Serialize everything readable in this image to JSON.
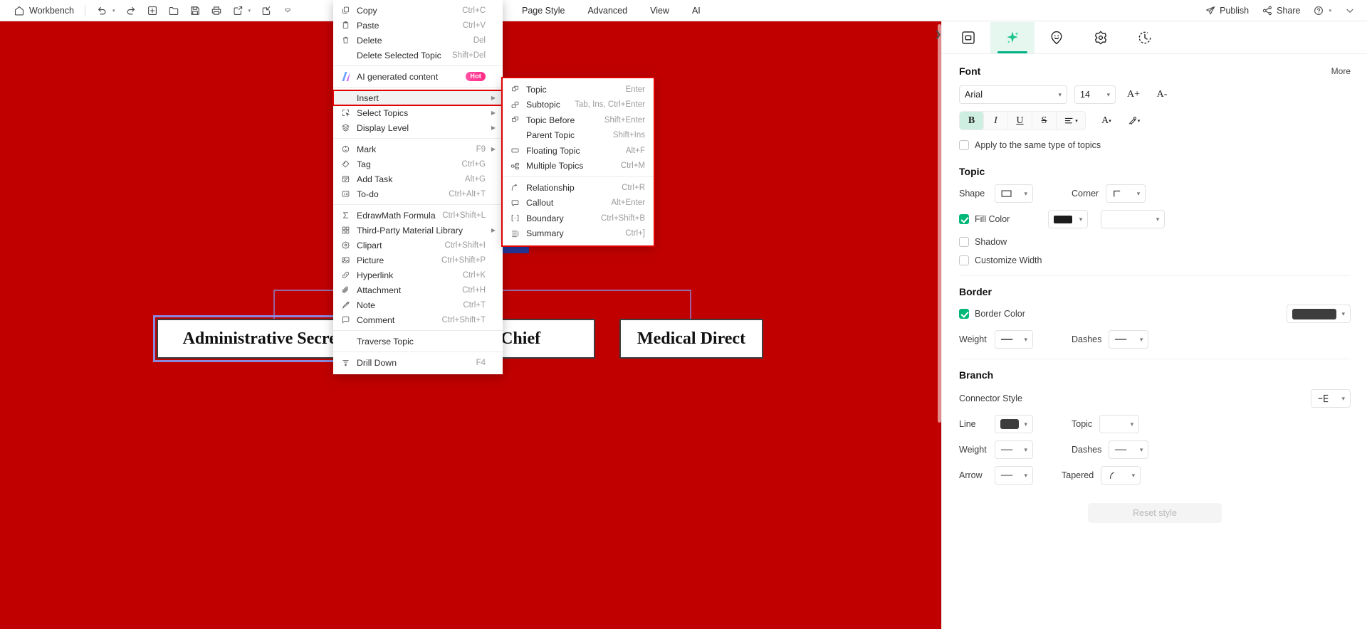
{
  "topbar": {
    "home_label": "Workbench",
    "left_tools": [
      {
        "name": "undo",
        "icon": "undo-icon",
        "caret": true
      },
      {
        "name": "redo",
        "icon": "redo-icon",
        "caret": false
      },
      {
        "name": "new",
        "icon": "new-file-icon",
        "caret": false
      },
      {
        "name": "open",
        "icon": "folder-open-icon",
        "caret": false
      },
      {
        "name": "save",
        "icon": "save-icon",
        "caret": false
      },
      {
        "name": "print",
        "icon": "print-icon",
        "caret": false
      },
      {
        "name": "export",
        "icon": "export-icon",
        "caret": true
      },
      {
        "name": "import",
        "icon": "import-icon",
        "caret": false
      },
      {
        "name": "more",
        "icon": "chevron-down-icon",
        "caret": false
      }
    ],
    "menu_tabs": [
      "Page Style",
      "Advanced",
      "View",
      "AI"
    ],
    "publish_label": "Publish",
    "share_label": "Share",
    "help_label": "?"
  },
  "context_menu": {
    "items": [
      {
        "label": "Copy",
        "shortcut": "Ctrl+C",
        "icon": "copy-icon",
        "arrow": false,
        "sep_after": false
      },
      {
        "label": "Paste",
        "shortcut": "Ctrl+V",
        "icon": "paste-icon",
        "arrow": false,
        "sep_after": false
      },
      {
        "label": "Delete",
        "shortcut": "Del",
        "icon": "trash-icon",
        "arrow": false,
        "sep_after": false
      },
      {
        "label": "Delete Selected Topic",
        "shortcut": "Shift+Del",
        "icon": "",
        "arrow": false,
        "sep_after": true
      },
      {
        "label": "AI generated content",
        "shortcut": "",
        "icon": "ai-icon",
        "arrow": false,
        "badge": "Hot",
        "sep_after": true
      },
      {
        "label": "Insert",
        "shortcut": "",
        "icon": "",
        "arrow": true,
        "highlight": true,
        "sep_after": false
      },
      {
        "label": "Select Topics",
        "shortcut": "",
        "icon": "select-topics-icon",
        "arrow": true,
        "sep_after": false
      },
      {
        "label": "Display Level",
        "shortcut": "",
        "icon": "layers-icon",
        "arrow": true,
        "sep_after": true
      },
      {
        "label": "Mark",
        "shortcut": "F9",
        "icon": "mark-icon",
        "arrow": true,
        "sep_after": false
      },
      {
        "label": "Tag",
        "shortcut": "Ctrl+G",
        "icon": "tag-icon",
        "arrow": false,
        "sep_after": false
      },
      {
        "label": "Add Task",
        "shortcut": "Alt+G",
        "icon": "task-icon",
        "arrow": false,
        "sep_after": false
      },
      {
        "label": "To-do",
        "shortcut": "Ctrl+Alt+T",
        "icon": "todo-icon",
        "arrow": false,
        "sep_after": true
      },
      {
        "label": "EdrawMath Formula",
        "shortcut": "Ctrl+Shift+L",
        "icon": "sigma-icon",
        "arrow": false,
        "sep_after": false
      },
      {
        "label": "Third-Party Material Library",
        "shortcut": "",
        "icon": "grid-icon",
        "arrow": true,
        "sep_after": false
      },
      {
        "label": "Clipart",
        "shortcut": "Ctrl+Shift+I",
        "icon": "clipart-icon",
        "arrow": false,
        "sep_after": false
      },
      {
        "label": "Picture",
        "shortcut": "Ctrl+Shift+P",
        "icon": "picture-icon",
        "arrow": false,
        "sep_after": false
      },
      {
        "label": "Hyperlink",
        "shortcut": "Ctrl+K",
        "icon": "link-icon",
        "arrow": false,
        "sep_after": false
      },
      {
        "label": "Attachment",
        "shortcut": "Ctrl+H",
        "icon": "attachment-icon",
        "arrow": false,
        "sep_after": false
      },
      {
        "label": "Note",
        "shortcut": "Ctrl+T",
        "icon": "note-icon",
        "arrow": false,
        "sep_after": false
      },
      {
        "label": "Comment",
        "shortcut": "Ctrl+Shift+T",
        "icon": "comment-icon",
        "arrow": false,
        "sep_after": true
      },
      {
        "label": "Traverse Topic",
        "shortcut": "",
        "icon": "",
        "arrow": false,
        "sep_after": true
      },
      {
        "label": "Drill Down",
        "shortcut": "F4",
        "icon": "drill-icon",
        "arrow": false,
        "sep_after": false
      }
    ]
  },
  "submenu": {
    "items": [
      {
        "label": "Topic",
        "shortcut": "Enter",
        "icon": "topic-icon",
        "sep_after": false
      },
      {
        "label": "Subtopic",
        "shortcut": "Tab, Ins, Ctrl+Enter",
        "icon": "subtopic-icon",
        "sep_after": false
      },
      {
        "label": "Topic Before",
        "shortcut": "Shift+Enter",
        "icon": "topic-before-icon",
        "sep_after": false
      },
      {
        "label": "Parent Topic",
        "shortcut": "Shift+Ins",
        "icon": "",
        "sep_after": false
      },
      {
        "label": "Floating Topic",
        "shortcut": "Alt+F",
        "icon": "floating-topic-icon",
        "sep_after": false
      },
      {
        "label": "Multiple Topics",
        "shortcut": "Ctrl+M",
        "icon": "multiple-topics-icon",
        "sep_after": true
      },
      {
        "label": "Relationship",
        "shortcut": "Ctrl+R",
        "icon": "relationship-icon",
        "sep_after": false
      },
      {
        "label": "Callout",
        "shortcut": "Alt+Enter",
        "icon": "callout-icon",
        "sep_after": false
      },
      {
        "label": "Boundary",
        "shortcut": "Ctrl+Shift+B",
        "icon": "boundary-icon",
        "sep_after": false
      },
      {
        "label": "Summary",
        "shortcut": "Ctrl+]",
        "icon": "summary-icon",
        "sep_after": false
      }
    ]
  },
  "canvas": {
    "background_color": "#c00000",
    "nodes": [
      {
        "label": "Administrative Secretary",
        "selected": true
      },
      {
        "label": "Fire Chief",
        "selected": false
      },
      {
        "label": "Medical Direct",
        "selected": false
      }
    ]
  },
  "right_panel": {
    "tabs": [
      {
        "name": "shape-tab",
        "icon": "square-in-square-icon",
        "active": false
      },
      {
        "name": "ai-style-tab",
        "icon": "sparkle-icon",
        "active": true
      },
      {
        "name": "emoji-tab",
        "icon": "smiley-pin-icon",
        "active": false
      },
      {
        "name": "sticker-tab",
        "icon": "flower-icon",
        "active": false
      },
      {
        "name": "history-tab",
        "icon": "clock-icon",
        "active": false
      }
    ],
    "font": {
      "title": "Font",
      "more_label": "More",
      "family": "Arial",
      "size": "14",
      "increase_label": "A+",
      "decrease_label": "A-",
      "bold_label": "B",
      "italic_label": "I",
      "underline_label": "U",
      "strike_label": "S",
      "align_label": "align",
      "text_color_label": "A",
      "highlight_label": "pen",
      "apply_same_label": "Apply to the same type of topics",
      "apply_same_checked": false,
      "bold_active": true
    },
    "topic": {
      "title": "Topic",
      "shape_label": "Shape",
      "corner_label": "Corner",
      "fill_color_label": "Fill Color",
      "fill_color_checked": true,
      "fill_color_value": "#1c1c1c",
      "shadow_label": "Shadow",
      "shadow_checked": false,
      "customize_width_label": "Customize Width",
      "customize_width_checked": false
    },
    "border": {
      "title": "Border",
      "border_color_label": "Border Color",
      "border_color_checked": true,
      "border_color_value": "#3d3d3d",
      "weight_label": "Weight",
      "dashes_label": "Dashes"
    },
    "branch": {
      "title": "Branch",
      "connector_style_label": "Connector Style",
      "line_label": "Line",
      "line_color_value": "#3d3d3d",
      "topic_label": "Topic",
      "weight_label": "Weight",
      "dashes_label": "Dashes",
      "arrow_label": "Arrow",
      "tapered_label": "Tapered"
    },
    "reset_label": "Reset style"
  },
  "colors": {
    "accent_green": "#00b386",
    "highlight_red": "#e00000",
    "canvas_red": "#c00000"
  }
}
